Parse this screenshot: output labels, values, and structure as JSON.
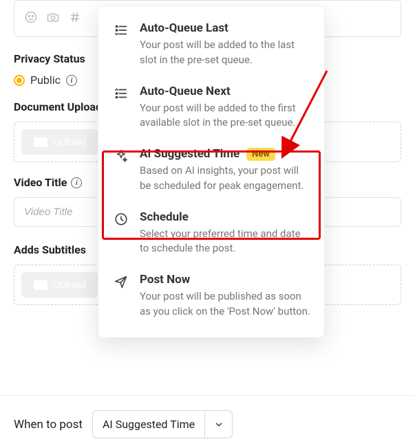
{
  "composer": {},
  "form": {
    "privacy_label": "Privacy Status",
    "public_label": "Public",
    "doc_upload_label": "Document Upload",
    "upload_btn": "Upload",
    "video_title_label": "Video Title",
    "video_title_placeholder": "Video Title",
    "subtitles_label": "Adds Subtitles",
    "upload_btn2": "Upload"
  },
  "dropdown": {
    "items": [
      {
        "title": "Auto-Queue Last",
        "desc": "Your post will be added to the last slot in the pre-set queue."
      },
      {
        "title": "Auto-Queue Next",
        "desc": "Your post will be added to the first available slot in the pre-set queue."
      },
      {
        "title": "AI Suggested Time",
        "badge": "New",
        "desc": "Based on AI insights, your post will be scheduled for peak engagement."
      },
      {
        "title": "Schedule",
        "desc": "Select your preferred time and date to schedule the post."
      },
      {
        "title": "Post Now",
        "desc": "Your post will be published as soon as you click on the 'Post Now' button."
      }
    ]
  },
  "when_to_post": {
    "label": "When to post",
    "selected": "AI Suggested Time"
  }
}
